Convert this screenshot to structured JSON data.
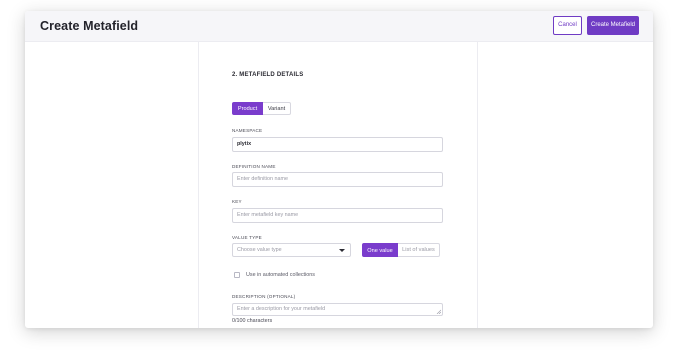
{
  "header": {
    "title": "Create Metafield",
    "cancel_label": "Cancel",
    "create_label": "Create Metafield"
  },
  "form": {
    "section_title": "2. METAFIELD DETAILS",
    "owner_toggle": {
      "options": [
        "Product",
        "Variant"
      ],
      "selected": "Product"
    },
    "namespace": {
      "label": "NAMESPACE",
      "value": "plytix"
    },
    "definition_name": {
      "label": "DEFINITION NAME",
      "placeholder": "Enter definition name"
    },
    "key": {
      "label": "KEY",
      "placeholder": "Enter metafield key name"
    },
    "value_type": {
      "label": "VALUE TYPE",
      "placeholder": "Choose value type",
      "cardinality_options": [
        "One value",
        "List of values"
      ],
      "selected_cardinality": "One value"
    },
    "automated_collections": {
      "label": "Use in automated collections",
      "checked": false
    },
    "description": {
      "label": "DESCRIPTION (OPTIONAL)",
      "placeholder": "Enter a description for your metafield",
      "char_count": "0/100 characters"
    }
  },
  "colors": {
    "accent": "#7a3ccc",
    "topbar_bg": "#f6f6f9"
  }
}
